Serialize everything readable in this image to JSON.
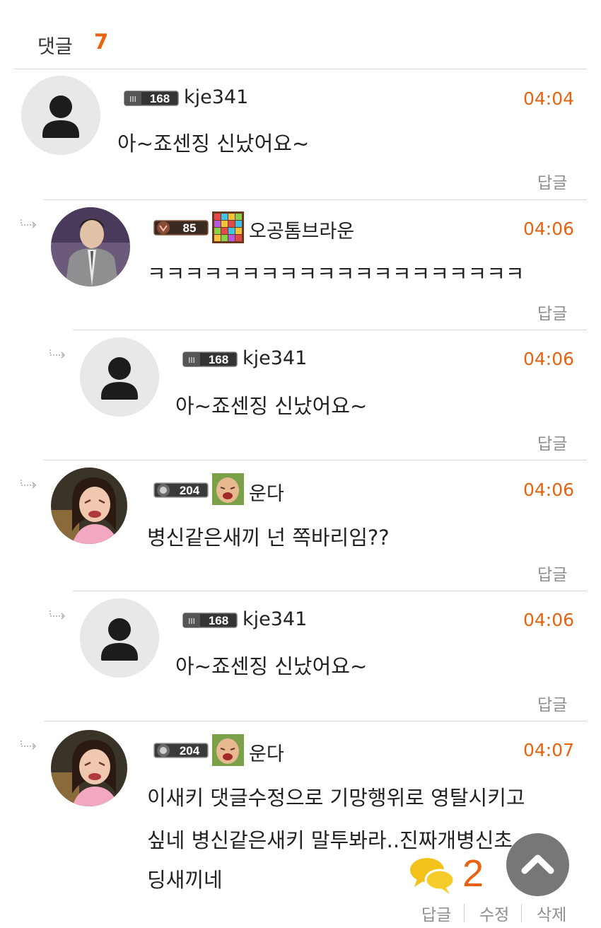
{
  "header": {
    "title": "댓글",
    "count": "7"
  },
  "comments": [
    {
      "level": "168",
      "nickname": "kje341",
      "time": "04:04",
      "text": "아~죠센징 신났어요~",
      "reply_label": "답글",
      "avatar": "default-user-icon"
    },
    {
      "level": "85",
      "nickname": "오공톰브라운",
      "time": "04:06",
      "text": "ㅋㅋㅋㅋㅋㅋㅋㅋㅋㅋㅋㅋㅋㅋㅋㅋㅋㅋㅋㅋ",
      "reply_label": "답글",
      "avatar": "photo-man-suit"
    },
    {
      "level": "168",
      "nickname": "kje341",
      "time": "04:06",
      "text": "아~죠센징 신났어요~",
      "reply_label": "답글",
      "avatar": "default-user-icon"
    },
    {
      "level": "204",
      "nickname": "운다",
      "time": "04:06",
      "text": "병신같은새끼 넌 쪽바리임??",
      "reply_label": "답글",
      "avatar": "photo-crying-girl"
    },
    {
      "level": "168",
      "nickname": "kje341",
      "time": "04:06",
      "text": "아~죠센징 신났어요~",
      "reply_label": "답글",
      "avatar": "default-user-icon"
    },
    {
      "level": "204",
      "nickname": "운다",
      "time": "04:07",
      "text_lines": [
        "이새키 댓글수정으로 기망행위로 영탈시키고",
        "싶네 병신같은새키 말투봐라..진짜개병신초",
        "딩새끼네"
      ],
      "avatar": "photo-crying-girl"
    }
  ],
  "bottom": {
    "reply": "답글",
    "edit": "수정",
    "delete": "삭제"
  },
  "fab": {
    "comment_count": "2",
    "comment_icon": "speech-bubbles-icon",
    "top_icon": "chevron-up-icon"
  },
  "colors": {
    "accent": "#e8620f",
    "muted": "#8e8e8e",
    "divider": "#d9d9d9"
  }
}
